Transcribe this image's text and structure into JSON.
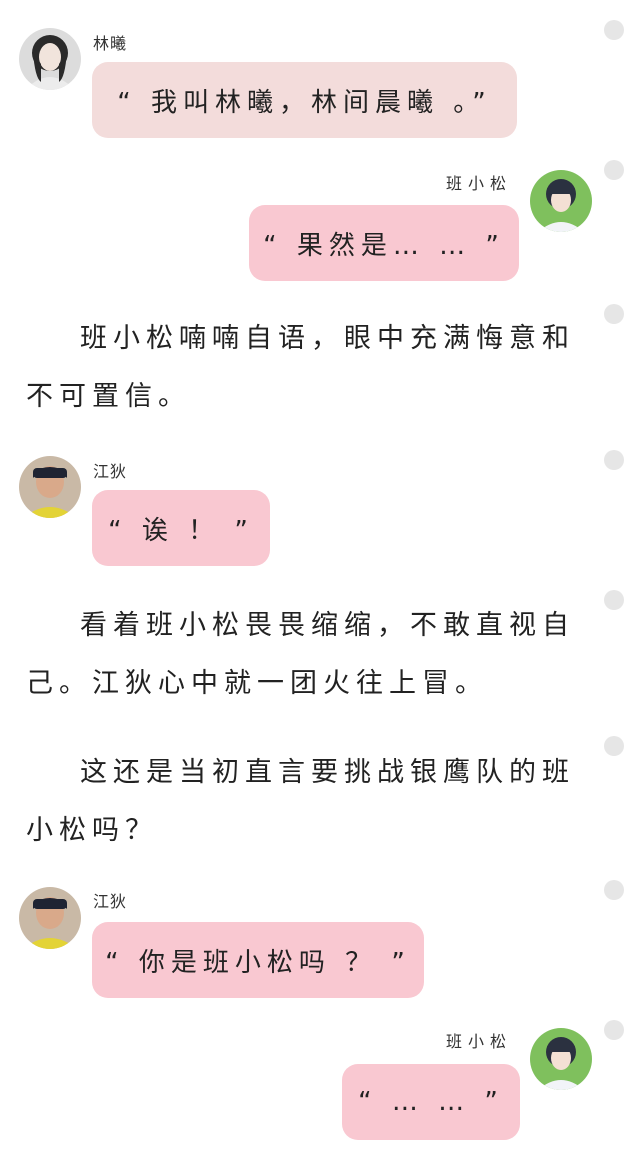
{
  "messages": [
    {
      "speaker": "林曦",
      "text": "“ 我叫林曦，林间晨曦 。”"
    },
    {
      "speaker": "班小松",
      "text": "“ 果然是… …  ”"
    },
    {
      "speaker": "江狄",
      "text": "“ 诶 ！ ”"
    },
    {
      "speaker": "江狄",
      "text": "“ 你是班小松吗 ？ ”"
    },
    {
      "speaker": "班小松",
      "text": "“ … …  ”"
    }
  ],
  "narration": [
    "班小松喃喃自语，眼中充满悔意和不可置信。",
    "看着班小松畏畏缩缩，不敢直视自己。江狄心中就一团火往上冒。",
    "这还是当初直言要挑战银鹰队的班小松吗？"
  ]
}
